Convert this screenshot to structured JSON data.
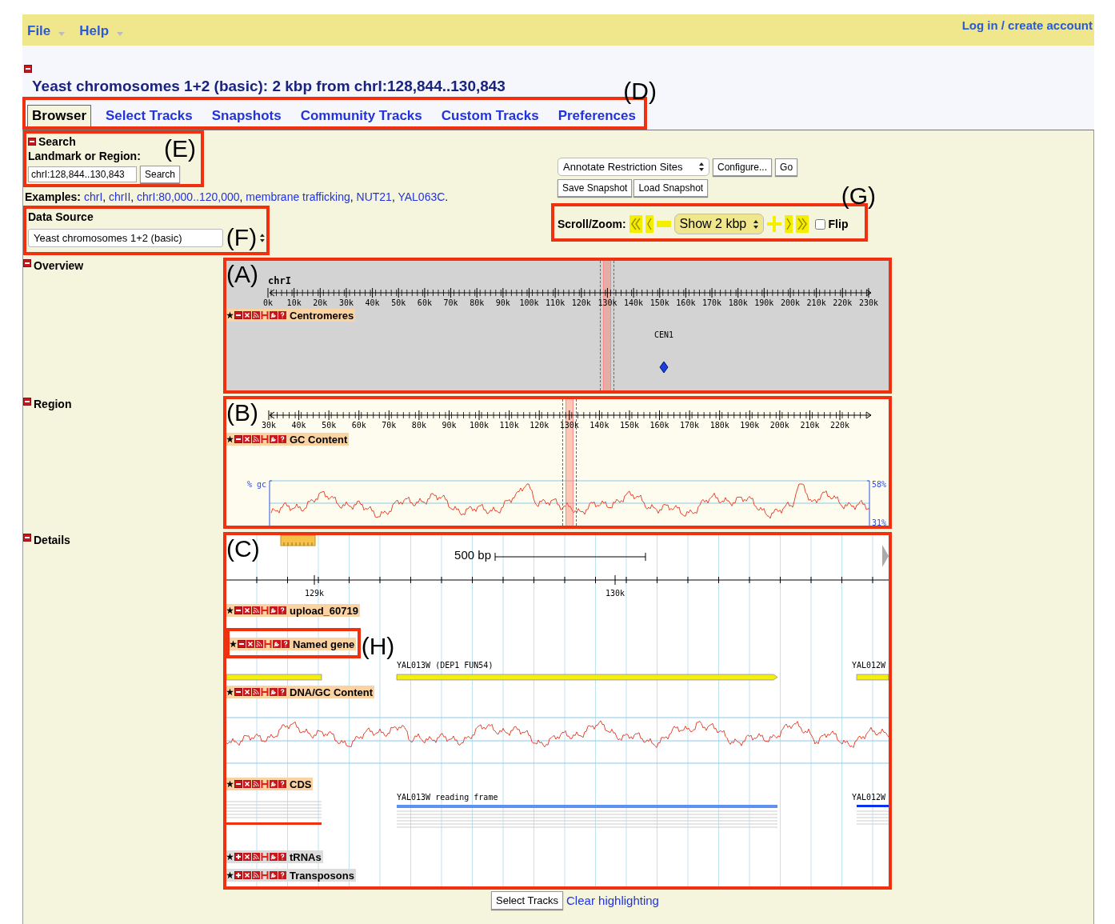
{
  "menu": {
    "items": [
      {
        "label": "File"
      },
      {
        "label": "Help"
      }
    ],
    "login": "Log in / create account"
  },
  "title": {
    "text": "Yeast chromosomes 1+2 (basic): 2 kbp from chrI:128,844..130,843",
    "expanded": true
  },
  "tabs": {
    "callout": "(D)",
    "items": [
      {
        "label": "Browser",
        "selected": true
      },
      {
        "label": "Select Tracks",
        "selected": false
      },
      {
        "label": "Snapshots",
        "selected": false
      },
      {
        "label": "Community Tracks",
        "selected": false
      },
      {
        "label": "Custom Tracks",
        "selected": false
      },
      {
        "label": "Preferences",
        "selected": false
      }
    ]
  },
  "search": {
    "callout": "(E)",
    "heading": "Search",
    "expanded": true,
    "label": "Landmark or Region:",
    "value": "chrI:128,844..130,843",
    "button": "Search"
  },
  "examples": {
    "label": "Examples:",
    "links": [
      {
        "text": "chrI",
        "after": ", "
      },
      {
        "text": "chrII",
        "after": ", "
      },
      {
        "text": "chrI:80,000..120,000",
        "after": ", "
      },
      {
        "text": "membrane trafficking",
        "after": ", "
      },
      {
        "text": "NUT21",
        "after": ", "
      },
      {
        "text": "YAL063C",
        "after": "."
      }
    ]
  },
  "data_source": {
    "callout": "(F)",
    "label": "Data Source",
    "value": "Yeast chromosomes 1+2 (basic)"
  },
  "annotate": {
    "select": "Annotate Restriction Sites",
    "buttons": [
      "Configure...",
      "Go"
    ]
  },
  "snapshot_buttons": [
    "Save Snapshot",
    "Load Snapshot"
  ],
  "scroll_zoom": {
    "callout": "(G)",
    "label": "Scroll/Zoom:",
    "zoom": "Show 2 kbp",
    "flip": {
      "label": "Flip",
      "checked": false
    }
  },
  "overview": {
    "label": "Overview",
    "expanded": true,
    "callout": "(A)",
    "chromosome": "chrI",
    "ticks": [
      "0k",
      "10k",
      "20k",
      "30k",
      "40k",
      "50k",
      "60k",
      "70k",
      "80k",
      "90k",
      "100k",
      "110k",
      "120k",
      "130k",
      "140k",
      "150k",
      "160k",
      "170k",
      "180k",
      "190k",
      "200k",
      "210k",
      "220k",
      "230k"
    ],
    "track": {
      "name": "Centromeres",
      "expanded": true
    },
    "feature": "CEN1"
  },
  "region": {
    "label": "Region",
    "expanded": true,
    "callout": "(B)",
    "ticks": [
      "30k",
      "40k",
      "50k",
      "60k",
      "70k",
      "80k",
      "90k",
      "100k",
      "110k",
      "120k",
      "130k",
      "140k",
      "150k",
      "160k",
      "170k",
      "180k",
      "190k",
      "200k",
      "210k",
      "220k"
    ],
    "track": {
      "name": "GC Content",
      "expanded": true
    },
    "plot": {
      "ylabel": "% gc",
      "max": "58%",
      "min": "31%"
    }
  },
  "details": {
    "label": "Details",
    "expanded": true,
    "callout": "(C)",
    "scale": "500 bp",
    "ticks": [
      "129k",
      "130k"
    ],
    "tracks": [
      {
        "kind": "empty",
        "name": "upload_60719",
        "expanded": true
      },
      {
        "kind": "genes",
        "name": "Named gene",
        "expanded": true,
        "callout": "(H)",
        "features": [
          "YAL013W (DEP1 FUN54)",
          "YAL012W"
        ]
      },
      {
        "kind": "wave",
        "name": "DNA/GC Content",
        "expanded": true
      },
      {
        "kind": "cds",
        "name": "CDS",
        "expanded": true,
        "features": [
          "YAL013W reading frame",
          "YAL012W"
        ]
      },
      {
        "kind": "collapsed",
        "name": "tRNAs",
        "expanded": false
      },
      {
        "kind": "collapsed",
        "name": "Transposons",
        "expanded": false
      }
    ]
  },
  "footer": {
    "button": "Select Tracks",
    "link": "Clear highlighting"
  }
}
